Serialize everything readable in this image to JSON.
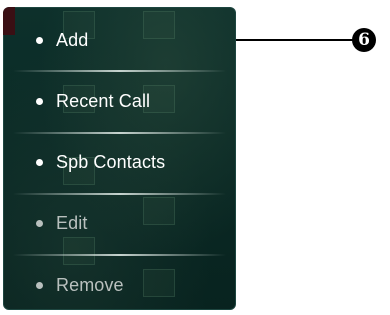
{
  "menu": {
    "items": [
      {
        "label": "Add",
        "enabled": true
      },
      {
        "label": "Recent Call",
        "enabled": true
      },
      {
        "label": "Spb Contacts",
        "enabled": true
      },
      {
        "label": "Edit",
        "enabled": false
      },
      {
        "label": "Remove",
        "enabled": false
      }
    ]
  },
  "callout": {
    "label": "6"
  },
  "colors": {
    "menu_background": "#0a2a26",
    "enabled_text": "#ffffff",
    "disabled_text": "#b9c0be",
    "callout": "#000000"
  }
}
